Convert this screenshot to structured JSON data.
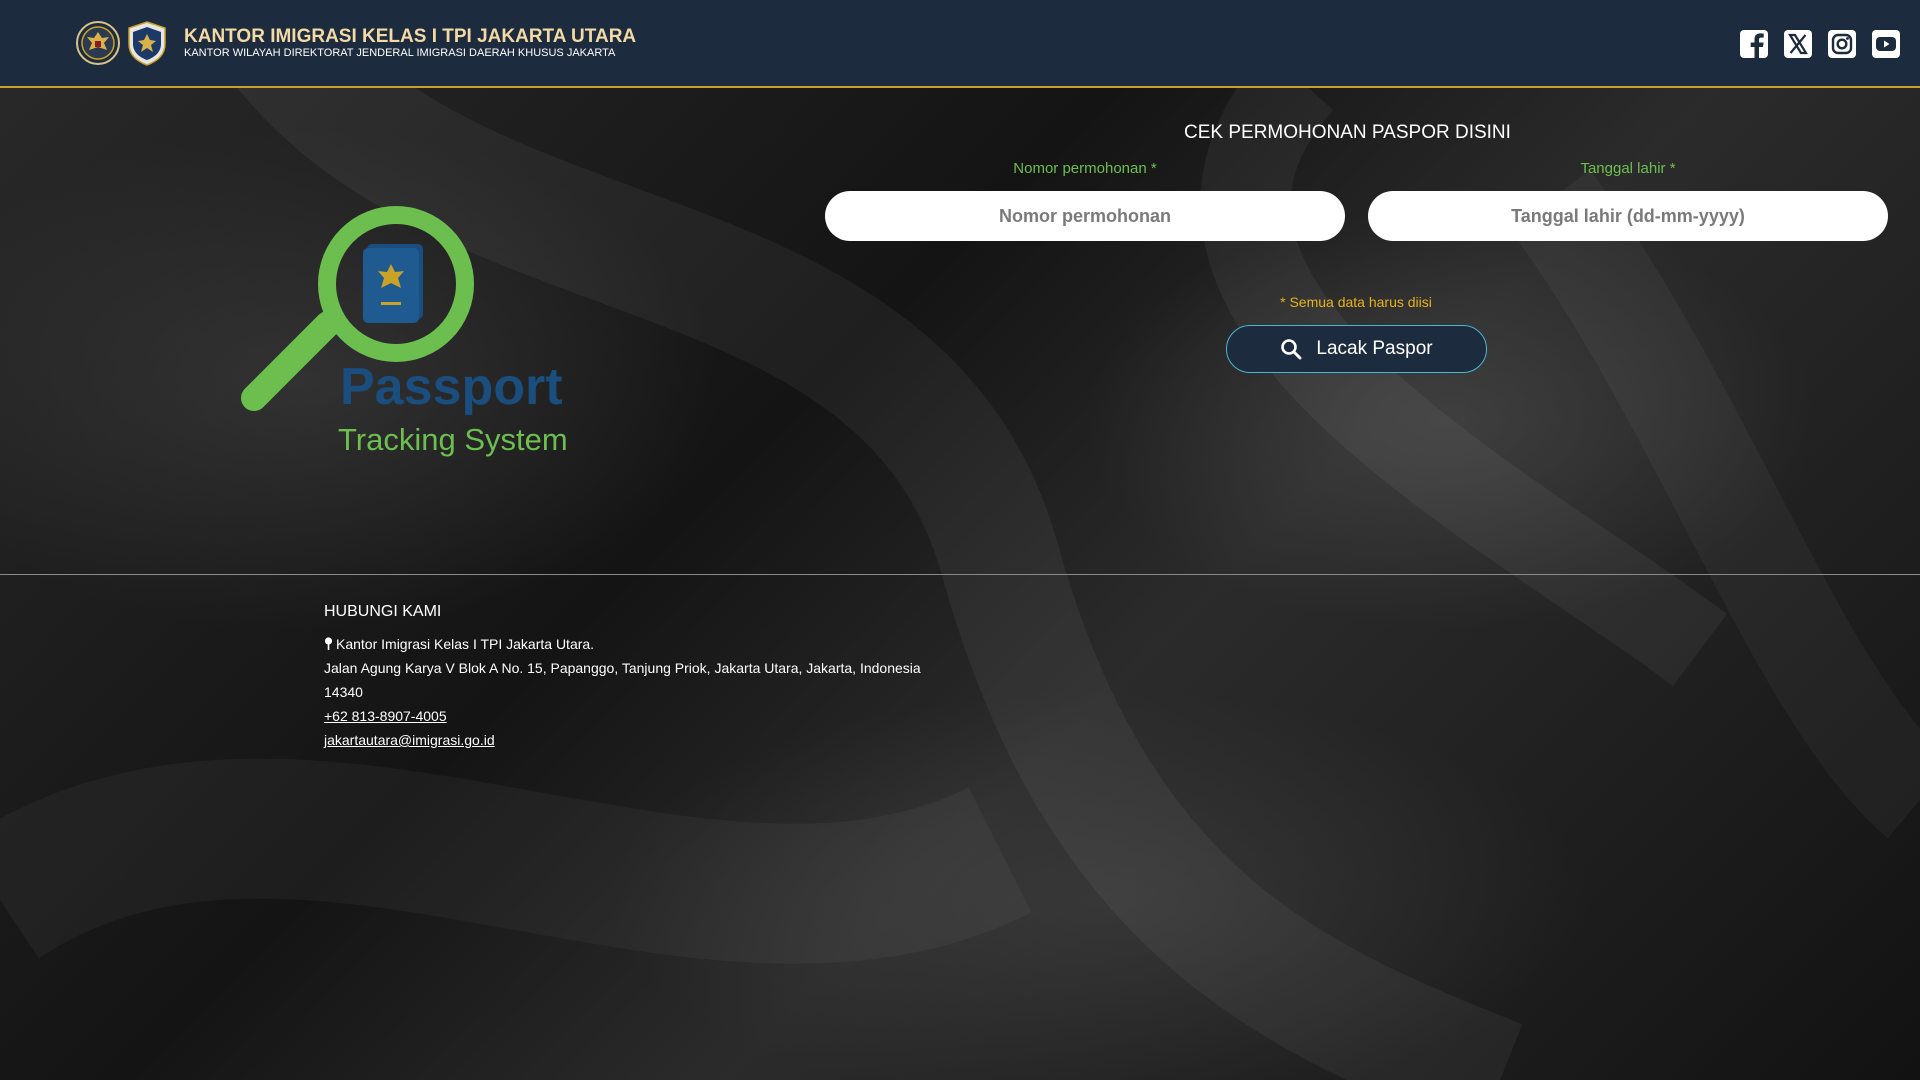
{
  "header": {
    "title": "KANTOR IMIGRASI KELAS I TPI JAKARTA UTARA",
    "subtitle": "KANTOR WILAYAH DIREKTORAT JENDERAL IMIGRASI DAERAH KHUSUS JAKARTA",
    "logos": [
      "garuda-emblem",
      "imigrasi-emblem"
    ],
    "social": [
      "facebook-icon",
      "x-twitter-icon",
      "instagram-icon",
      "youtube-icon"
    ]
  },
  "hero": {
    "logo_text_main": "Passport",
    "logo_text_sub": "Tracking System"
  },
  "form": {
    "title": "CEK PERMOHONAN PASPOR DISINI",
    "nomor_label": "Nomor permohonan *",
    "nomor_placeholder": "Nomor permohonan",
    "tgl_label": "Tanggal lahir *",
    "tgl_placeholder": "Tanggal lahir (dd-mm-yyyy)",
    "required_note": "* Semua data harus diisi",
    "submit_label": "Lacak Paspor"
  },
  "footer": {
    "title": "HUBUNGI KAMI",
    "office": "Kantor Imigrasi Kelas I TPI Jakarta Utara.",
    "address_line1": "Jalan Agung Karya V Blok A No. 15, Papanggo, Tanjung Priok, Jakarta Utara, Jakarta, Indonesia",
    "address_line2": "14340",
    "phone": "+62 813-8907-4005",
    "email": "jakartautara@imigrasi.go.id"
  },
  "colors": {
    "header_bg": "#1d2b3e",
    "header_title": "#f3d9a4",
    "accent_green": "#6cbf4f",
    "note_yellow": "#e8b21c",
    "button_border": "#49b7d4",
    "logo_blue": "#1a4e7e"
  }
}
